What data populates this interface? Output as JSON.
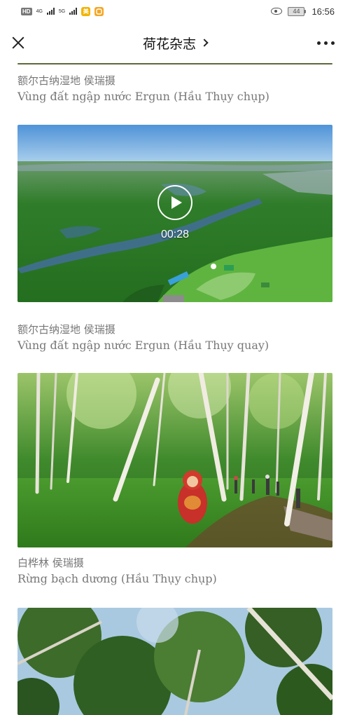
{
  "status_bar": {
    "hd_label": "HD",
    "hd_sub": "2",
    "net1": "4G",
    "net2": "5G",
    "app1_label": "美",
    "battery": "44",
    "time": "16:56",
    "icons": [
      "eye-icon",
      "battery-icon",
      "signal-icon"
    ]
  },
  "nav": {
    "title": "荷花杂志",
    "close_icon": "close-icon",
    "more_icon": "more-icon"
  },
  "items": [
    {
      "caption_zh": "额尔古纳湿地 侯瑞摄",
      "caption_vi": "Vùng đất ngập nước Ergun (Hầu Thụy chụp)"
    },
    {
      "type": "video",
      "duration": "00:28",
      "caption_zh": "额尔古纳湿地 侯瑞摄",
      "caption_vi": "Vùng đất ngập nước Ergun (Hầu Thụy quay)"
    },
    {
      "type": "image",
      "caption_zh": "白桦林 侯瑞摄",
      "caption_vi": "Rừng bạch dương (Hầu Thụy chụp)"
    },
    {
      "type": "image"
    }
  ],
  "colors": {
    "caption_text": "#777777",
    "title_text": "#111111",
    "app_badge_yellow": "#f2b400",
    "app_badge_orange": "#f5a623"
  }
}
